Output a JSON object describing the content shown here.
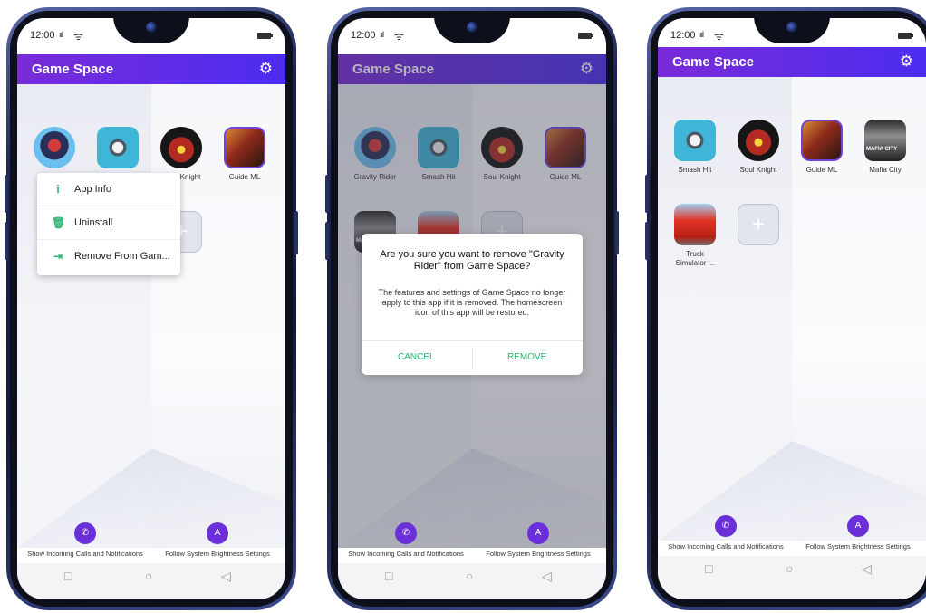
{
  "status": {
    "time": "12:00",
    "signal": "ııl",
    "wifi": "ᯤ"
  },
  "appbar": {
    "title": "Game Space",
    "settings_icon": "⚙"
  },
  "apps": {
    "gravity_rider": "Gravity Rider",
    "smash_hit": "Smash Hit",
    "soul_knight": "Soul Knight",
    "soul_knight_partial": "Knight",
    "guide_ml": "Guide ML",
    "mafia_city": "Mafia City",
    "truck_simulator": "Truck Simulator ...",
    "add_icon": "+"
  },
  "context_menu": {
    "items": [
      {
        "icon": "i",
        "label": "App Info"
      },
      {
        "icon": "🗑",
        "label": "Uninstall"
      },
      {
        "icon": "⇥",
        "label": "Remove From Gam..."
      }
    ]
  },
  "dialog": {
    "title": "Are you sure you want to remove \"Gravity Rider\" from Game Space?",
    "body": "The features and settings of Game Space no longer apply to this app if it is removed. The homescreen icon of this app will be restored.",
    "cancel": "CANCEL",
    "remove": "REMOVE"
  },
  "quick": {
    "calls_icon": "✆",
    "calls_label": "Show Incoming Calls and Notifications",
    "brightness_icon": "A",
    "brightness_label": "Follow System Brightness Settings"
  },
  "nav": {
    "recent": "□",
    "home": "○",
    "back": "◁"
  },
  "colors": {
    "accent_purple": "#6a2fd8",
    "accent_green": "#2bb673",
    "appbar_gradient_start": "#7a2bd9",
    "appbar_gradient_end": "#4c2cf0"
  }
}
